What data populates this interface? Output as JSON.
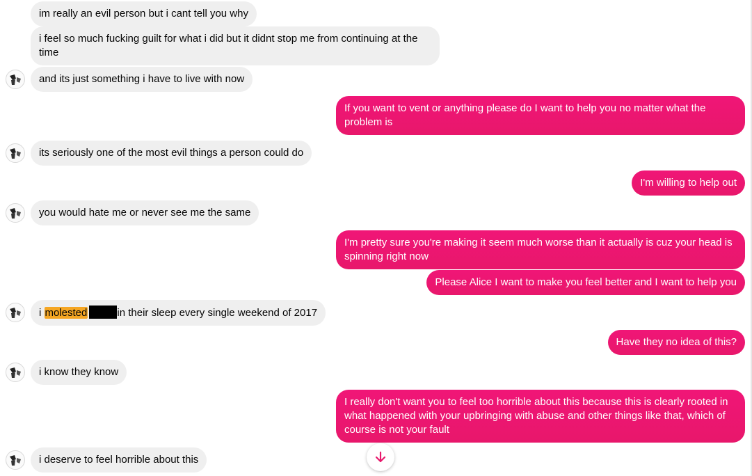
{
  "messages": {
    "m1": "im really an evil person but i cant tell you why",
    "m2": "i feel so much fucking guilt for what i did but it didnt stop me from continuing at the time",
    "m3": "and its just something i have to live with now",
    "m4": "If you want to vent or anything please do I want to help you no matter what the problem is",
    "m5": "its seriously one of the most evil things a person could do",
    "m6": "I'm willing to help out",
    "m7": "you would hate me or never see me the same",
    "m8": "I'm pretty sure you're making it seem much worse than it actually is cuz your head is spinning right now",
    "m9": "Please Alice I want to make you feel better and I want to help you",
    "m10_pre": "i ",
    "m10_highlight": "molested",
    "m10_post": "in their sleep every single weekend of 2017",
    "m11": "Have they no idea of this?",
    "m12": "i know they know",
    "m13": "I really don't want you to feel too horrible about this because this is clearly rooted in what happened with your upbringing with abuse and other things like that, which of course is not your fault",
    "m14": "i deserve to feel horrible about this"
  },
  "colors": {
    "incoming_bubble": "#efefef",
    "outgoing_bubble": "#ed1771",
    "highlight": "#f5a623",
    "scroll_arrow": "#e8176b"
  },
  "icons": {
    "avatar": "avatar-icon",
    "scroll": "arrow-down-icon"
  }
}
